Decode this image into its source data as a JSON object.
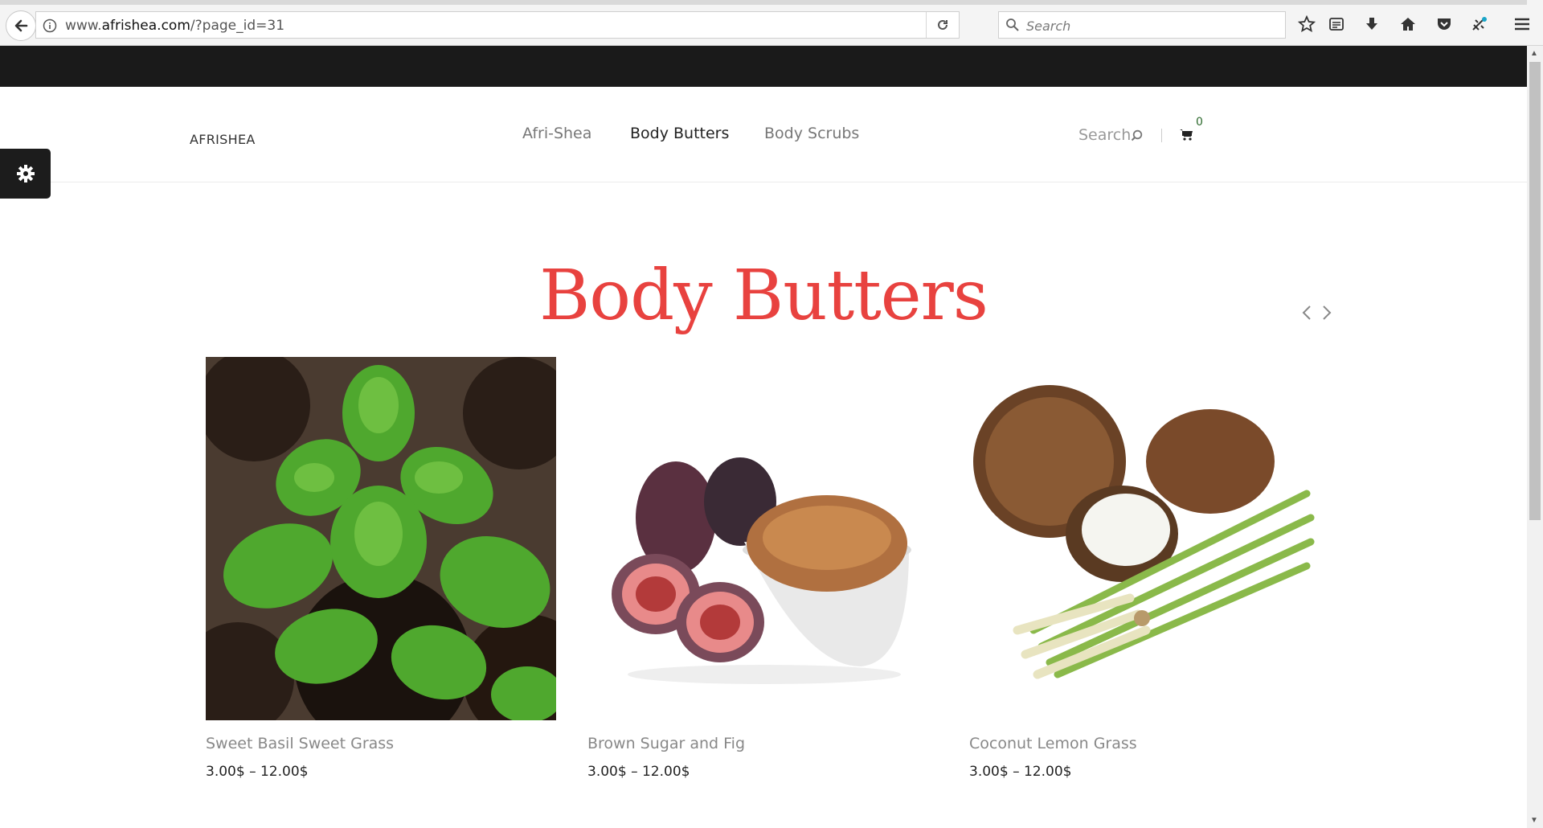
{
  "browser": {
    "url_prefix": "www.",
    "url_domain": "afrishea.com",
    "url_path": "/?page_id=31",
    "search_placeholder": "Search"
  },
  "site": {
    "brand": "AFRISHEA",
    "nav": [
      {
        "label": "Afri-Shea",
        "active": false
      },
      {
        "label": "Body Butters",
        "active": true
      },
      {
        "label": "Body Scrubs",
        "active": false
      }
    ],
    "search_label": "Search",
    "cart_count": "0"
  },
  "section": {
    "title": "Body Butters",
    "title_color": "#e8423f"
  },
  "products": [
    {
      "name": "Sweet Basil Sweet Grass",
      "price": "3.00$ – 12.00$",
      "image": "basil-plant-image"
    },
    {
      "name": "Brown Sugar and Fig",
      "price": "3.00$ – 12.00$",
      "image": "figs-and-brown-sugar-image"
    },
    {
      "name": "Coconut Lemon Grass",
      "price": "3.00$ – 12.00$",
      "image": "coconut-and-lemongrass-image"
    }
  ]
}
